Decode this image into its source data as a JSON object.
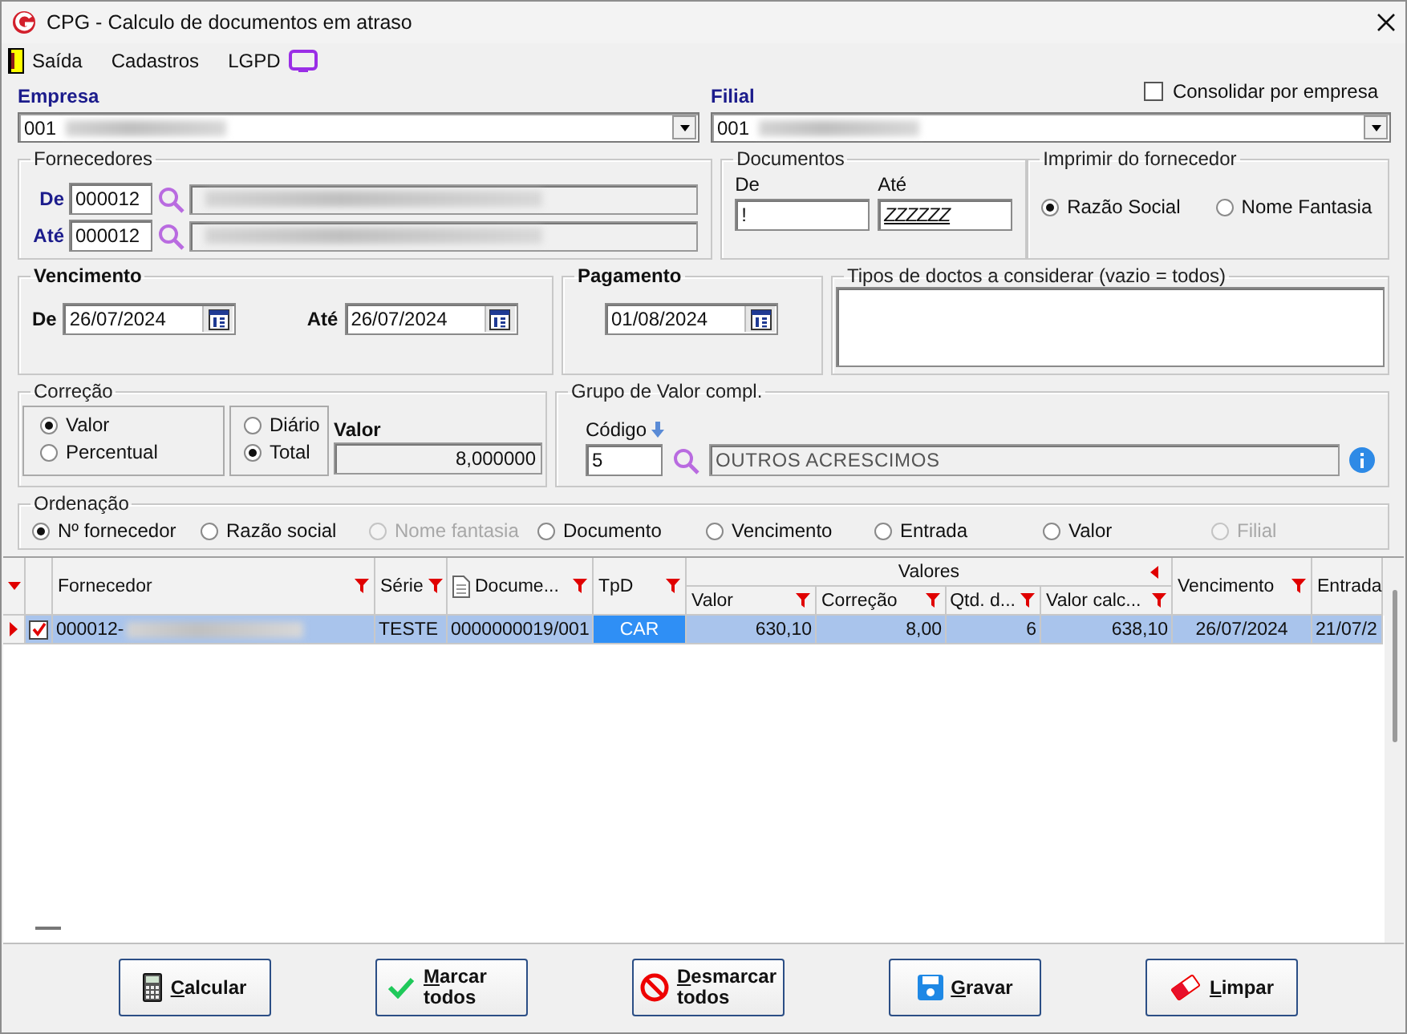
{
  "window": {
    "title": "CPG - Calculo de documentos em atraso"
  },
  "menu": [
    {
      "label": "Saída",
      "kind": "door"
    },
    {
      "label": "Cadastros",
      "kind": "none"
    },
    {
      "label": "LGPD",
      "kind": "monitor"
    }
  ],
  "empresa": {
    "label": "Empresa",
    "value": "001",
    "redacted": true
  },
  "consolidar": {
    "label": "Consolidar por empresa",
    "checked": false
  },
  "filial": {
    "label": "Filial",
    "value": "001",
    "redacted": true
  },
  "fornecedores": {
    "title": "Fornecedores",
    "de_label": "De",
    "de": "000012",
    "ate_label": "Até",
    "ate": "000012",
    "redacted": true
  },
  "documentos": {
    "title": "Documentos",
    "de_label": "De",
    "de": "!",
    "ate_label": "Até",
    "ate": "ZZZZZZ"
  },
  "imprimir": {
    "title": "Imprimir do fornecedor",
    "options": [
      {
        "label": "Razão Social",
        "selected": true
      },
      {
        "label": "Nome Fantasia",
        "selected": false
      }
    ]
  },
  "vencimento": {
    "title": "Vencimento",
    "de_label": "De",
    "de": "26/07/2024",
    "ate_label": "Até",
    "ate": "26/07/2024"
  },
  "pagamento": {
    "title": "Pagamento",
    "value": "01/08/2024"
  },
  "tipos": {
    "title": "Tipos de doctos a considerar (vazio = todos)"
  },
  "correcao": {
    "title": "Correção",
    "tipo": [
      {
        "label": "Valor",
        "selected": true
      },
      {
        "label": "Percentual",
        "selected": false
      }
    ],
    "periodo": [
      {
        "label": "Diário",
        "selected": false
      },
      {
        "label": "Total",
        "selected": true
      }
    ],
    "valor_label": "Valor",
    "valor": "8,000000"
  },
  "grupo": {
    "title": "Grupo de Valor compl.",
    "codigo_label": "Código",
    "codigo": "5",
    "descricao": "OUTROS ACRESCIMOS"
  },
  "ordenacao": {
    "title": "Ordenação",
    "options": [
      {
        "label": "Nº fornecedor",
        "selected": true,
        "disabled": false
      },
      {
        "label": "Razão social",
        "selected": false,
        "disabled": false
      },
      {
        "label": "Nome fantasia",
        "selected": false,
        "disabled": true
      },
      {
        "label": "Documento",
        "selected": false,
        "disabled": false
      },
      {
        "label": "Vencimento",
        "selected": false,
        "disabled": false
      },
      {
        "label": "Entrada",
        "selected": false,
        "disabled": false
      },
      {
        "label": "Valor",
        "selected": false,
        "disabled": false
      },
      {
        "label": "Filial",
        "selected": false,
        "disabled": true
      }
    ]
  },
  "table": {
    "columns": [
      {
        "label": "Fornecedor",
        "kind": "text",
        "filter": true
      },
      {
        "label": "Série",
        "kind": "text",
        "filter": true
      },
      {
        "label": "Docume...",
        "kind": "document",
        "filter": true
      },
      {
        "label": "TpD",
        "kind": "text",
        "filter": true
      },
      {
        "label": "Valor",
        "kind": "text",
        "filter": true,
        "in_group": true
      },
      {
        "label": "Correção",
        "kind": "text",
        "filter": true,
        "in_group": true
      },
      {
        "label": "Qtd. d...",
        "kind": "text",
        "filter": true,
        "in_group": true
      },
      {
        "label": "Valor calc...",
        "kind": "text",
        "filter": true,
        "in_group": true
      },
      {
        "label": "Vencimento",
        "kind": "text",
        "filter": true
      },
      {
        "label": "Entrada",
        "kind": "text",
        "filter": false
      }
    ],
    "column_group": {
      "label": "Valores"
    },
    "rows": [
      {
        "selected": true,
        "checked": true,
        "redacted": true,
        "cells": [
          {
            "text": "000012-",
            "focused": false
          },
          {
            "text": "TESTE",
            "focused": false
          },
          {
            "text": "0000000019/001",
            "focused": false
          },
          {
            "text": "CAR",
            "focused": true
          },
          {
            "text": "630,10",
            "focused": false
          },
          {
            "text": "8,00",
            "focused": false
          },
          {
            "text": "6",
            "focused": false
          },
          {
            "text": "638,10",
            "focused": false
          },
          {
            "text": "26/07/2024",
            "focused": false
          },
          {
            "text": "21/07/2",
            "focused": false
          }
        ]
      }
    ]
  },
  "buttons": [
    {
      "label": "Calcular",
      "kind": "calculator"
    },
    {
      "label": "Marcar todos",
      "kind": "check"
    },
    {
      "label": "Desmarcar todos",
      "kind": "cancel"
    },
    {
      "label": "Gravar",
      "kind": "floppy"
    },
    {
      "label": "Limpar",
      "kind": "eraser"
    }
  ]
}
